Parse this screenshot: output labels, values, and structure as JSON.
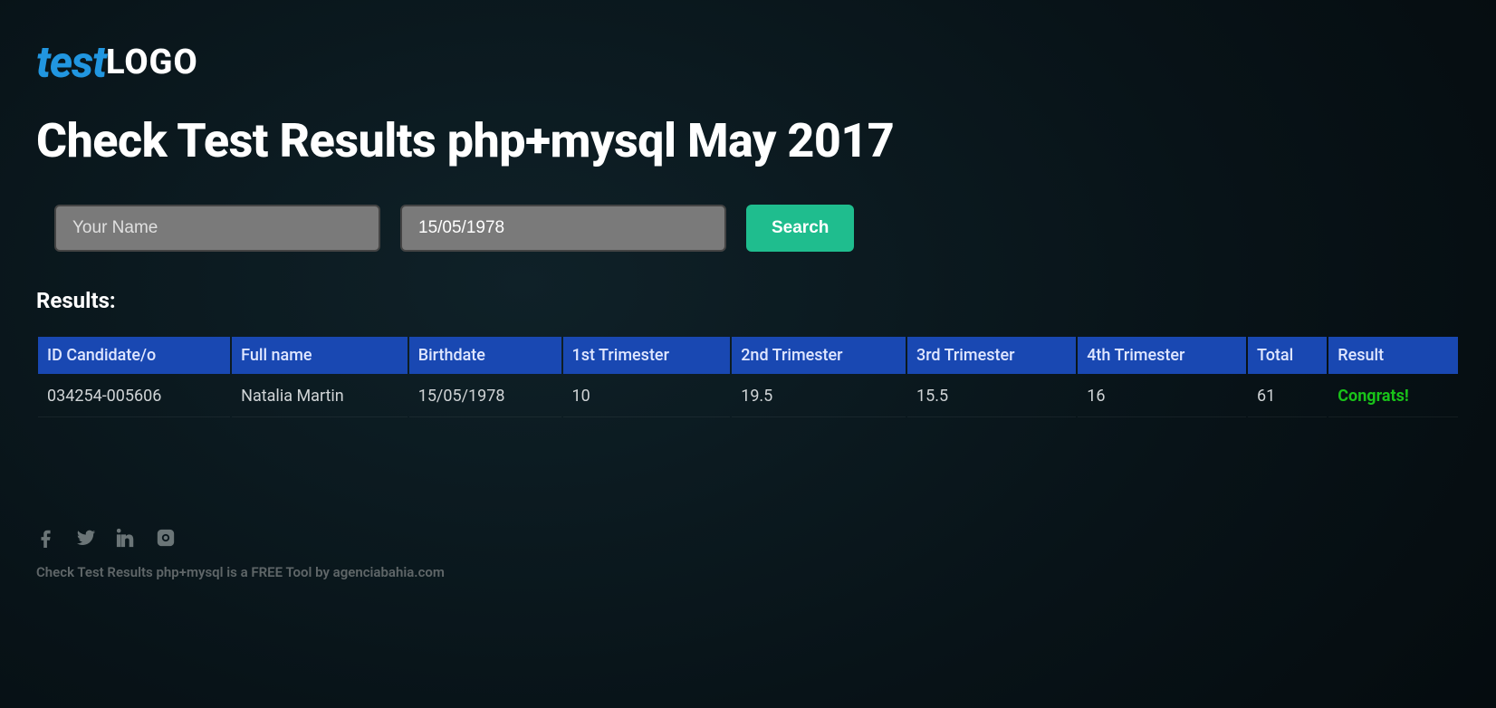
{
  "logo": {
    "prefix": "test",
    "suffix": "LOGO"
  },
  "title": "Check Test Results php+mysql May 2017",
  "search": {
    "name_placeholder": "Your Name",
    "date_value": "15/05/1978",
    "button_label": "Search"
  },
  "results": {
    "label": "Results:",
    "headers": [
      "ID Candidate/o",
      "Full name",
      "Birthdate",
      "1st Trimester",
      "2nd Trimester",
      "3rd Trimester",
      "4th Trimester",
      "Total",
      "Result"
    ],
    "rows": [
      {
        "cells": [
          "034254-005606",
          "Natalia Martin",
          "15/05/1978",
          "10",
          "19.5",
          "15.5",
          "16",
          "61",
          "Congrats!"
        ],
        "result_class": "congrats"
      }
    ]
  },
  "footer": {
    "text": "Check Test Results php+mysql is a FREE Tool by agenciabahia.com"
  }
}
